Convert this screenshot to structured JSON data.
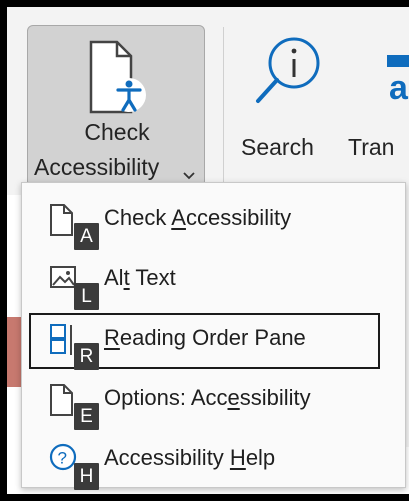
{
  "ribbon": {
    "check_accessibility": {
      "line1": "Check",
      "line2": "Accessibility"
    },
    "search": {
      "label": "Search"
    },
    "translate": {
      "label": "Tran"
    }
  },
  "menu": {
    "items": [
      {
        "pre": "Check ",
        "mnemonic": "A",
        "post": "ccessibility",
        "keytip": "A",
        "icon": "check-accessibility-icon"
      },
      {
        "pre": "Al",
        "mnemonic": "t",
        "post": " Text",
        "keytip": "L",
        "icon": "alt-text-icon"
      },
      {
        "pre": "",
        "mnemonic": "R",
        "post": "eading Order Pane",
        "keytip": "R",
        "icon": "reading-order-icon"
      },
      {
        "pre": "Options: Acc",
        "mnemonic": "e",
        "post": "ssibility",
        "keytip": "E",
        "icon": "options-document-icon"
      },
      {
        "pre": "Accessibility ",
        "mnemonic": "H",
        "post": "elp",
        "keytip": "H",
        "icon": "help-icon"
      }
    ],
    "selected_index": 2
  },
  "colors": {
    "accent": "#0f6cbd",
    "keytip_bg": "#3b3b3b",
    "selection_border": "#1a1a1a"
  }
}
